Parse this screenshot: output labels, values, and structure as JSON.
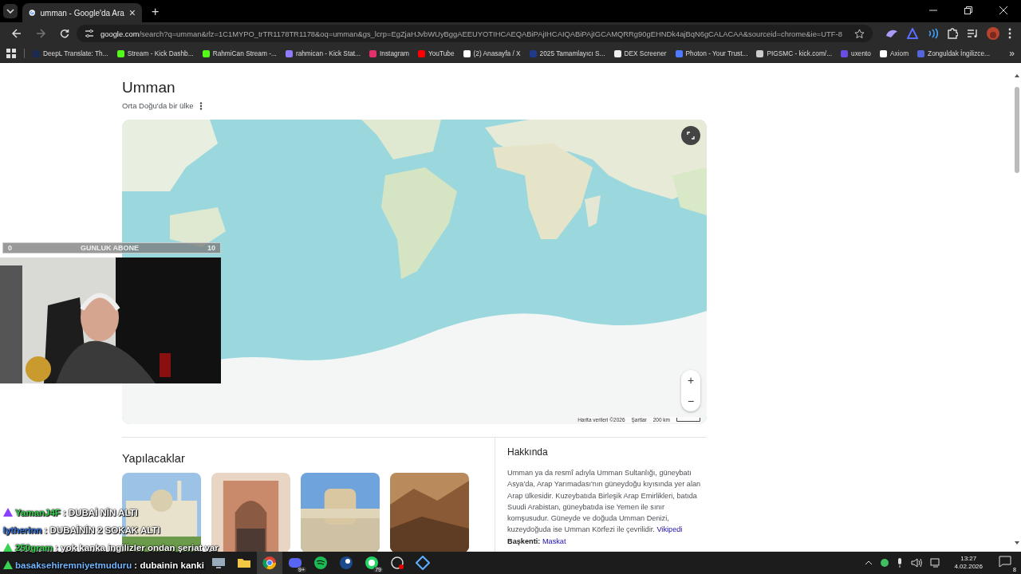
{
  "browser": {
    "tab": {
      "title": "umman - Google'da Ara",
      "close": "×"
    },
    "new_tab": "+",
    "url": {
      "host": "google.com",
      "path": "/search?q=umman&rlz=1C1MYPO_trTR1178TR1178&oq=umman&gs_lcrp=EgZjaHJvbWUyBggAEEUYOTIHCAEQABiPAjIHCAIQABiPAjIGCAMQRRg90gEHNDk4ajBqN6gCALACAA&sourceid=chrome&ie=UTF-8"
    },
    "bookmarks": [
      {
        "label": "DeepL Translate: Th..."
      },
      {
        "label": "Stream - Kick Dashb..."
      },
      {
        "label": "RahmiCan Stream -..."
      },
      {
        "label": "rahmican - Kick Stat..."
      },
      {
        "label": "Instagram"
      },
      {
        "label": "YouTube"
      },
      {
        "label": "(2) Anasayfa / X"
      },
      {
        "label": "2025 Tamamlayıcı S..."
      },
      {
        "label": "DEX Screener"
      },
      {
        "label": "Photon - Your Trust..."
      },
      {
        "label": "PIGSMC - kick.com/..."
      },
      {
        "label": "uxento"
      },
      {
        "label": "Axiom"
      },
      {
        "label": "Zonguldak İngilizce..."
      }
    ],
    "more": "»"
  },
  "entity": {
    "title": "Umman",
    "subtitle": "Orta Doğu'da bir ülke",
    "map": {
      "kind": "picture",
      "zoom_in": "+",
      "zoom_out": "−",
      "attribution": "Harita verileri ©2026",
      "terms": "Şartlar",
      "scale": "200 km"
    }
  },
  "things_to_do": {
    "title": "Yapılacaklar"
  },
  "about": {
    "title": "Hakkında",
    "text": "Umman ya da resmî adıyla Umman Sultanlığı, güneybatı Asya'da, Arap Yarımadası'nın güneydoğu kıyısında yer alan Arap ülkesidir. Kuzeybatıda Birleşik Arap Emirlikleri, batıda Suudi Arabistan, güneybatıda ise Yemen ile sınır komşusudur. Güneyde ve doğuda Umman Denizi, kuzeydoğuda ise Umman Körfezi ile çevrilidir.",
    "source": "Vikipedi",
    "capital_label": "Başkenti:",
    "capital": "Maskat"
  },
  "stream_overlay": {
    "sub_goal": {
      "min": "0",
      "label": "GUNLUK ABONE",
      "max": "10"
    },
    "chat": [
      {
        "user": "YamanJ4F",
        "color": "#39d353",
        "badge": {
          "color": "#8a3ffc"
        },
        "message": ": DUBAİ NİN ALTI"
      },
      {
        "user": "lytherinn",
        "color": "#2f6fd8",
        "message": ": DUBAİNİN 2 SOKAK ALTI"
      },
      {
        "user": "250gram",
        "color": "#39d353",
        "badge": {
          "color": "#39d353"
        },
        "message": ": yok kanka ingilizler ondan şeriat var"
      },
      {
        "user": "basaksehiremniyetmuduru",
        "color": "#6fb6ff",
        "badge": {
          "color": "#39d353"
        },
        "message": ": dubainin kanki"
      }
    ]
  },
  "taskbar": {
    "apps": [
      {
        "selected": false
      },
      {
        "selected": false
      },
      {
        "selected": true
      },
      {
        "selected": false,
        "badge": "9+"
      },
      {
        "selected": false
      },
      {
        "selected": false
      },
      {
        "selected": false,
        "badge": "79"
      },
      {
        "selected": false
      },
      {
        "selected": false
      }
    ],
    "time": "13:27",
    "date": "4.02.2026",
    "notifications": "8"
  }
}
